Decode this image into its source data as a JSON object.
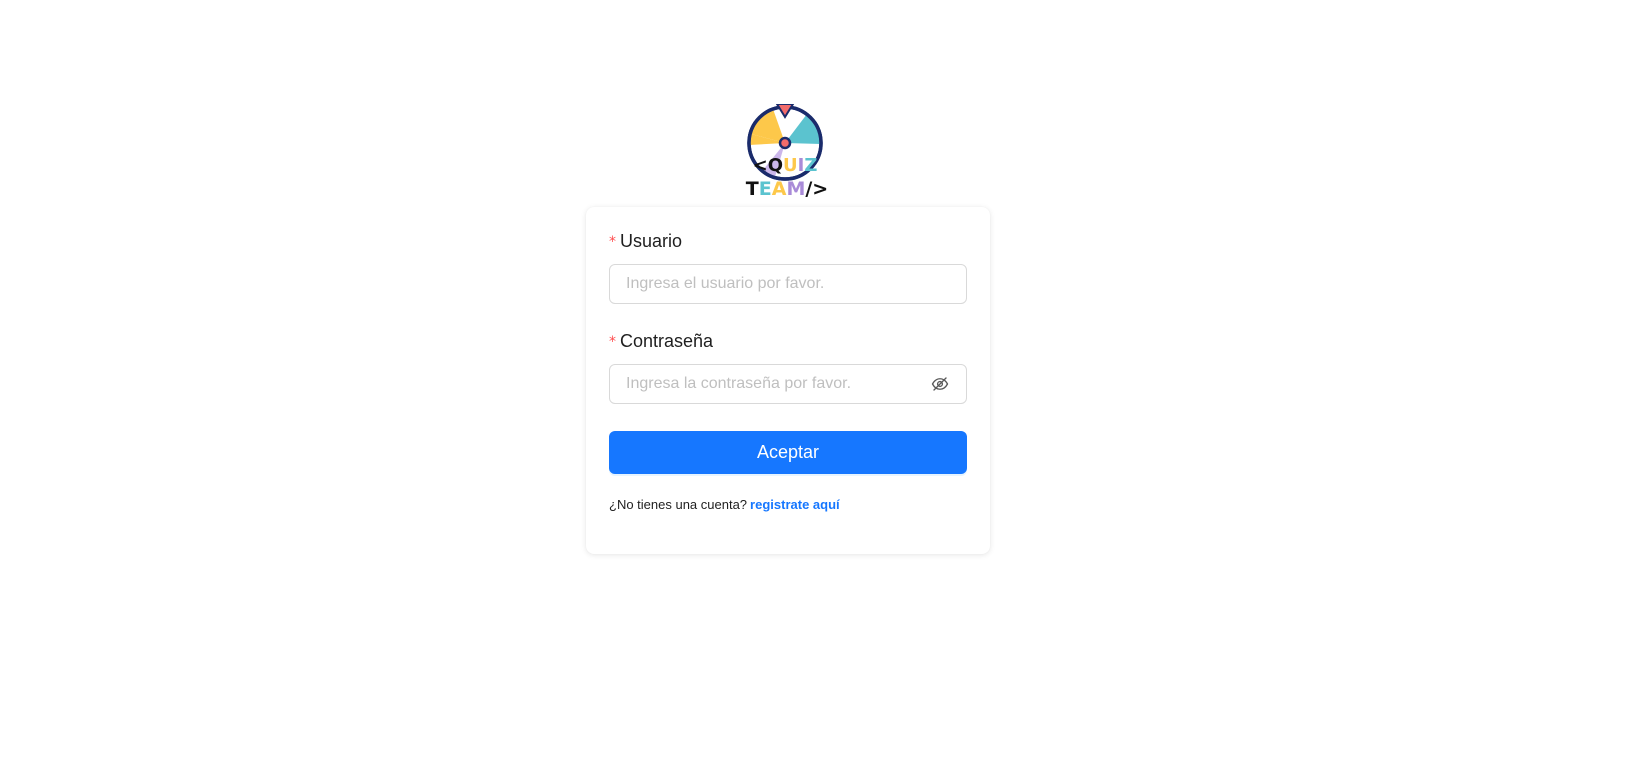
{
  "logo": {
    "alt": "QUIZ TEAM logo",
    "line1": "<QUIZ",
    "line2": "TEAM/>",
    "colors": {
      "navy": "#1a2b6b",
      "yellow": "#fdc84a",
      "teal": "#5bc3cf",
      "pink": "#f26b6b",
      "purple": "#a98bd8"
    }
  },
  "form": {
    "username": {
      "label": "Usuario",
      "required_mark": "*",
      "placeholder": "Ingresa el usuario por favor.",
      "value": ""
    },
    "password": {
      "label": "Contraseña",
      "required_mark": "*",
      "placeholder": "Ingresa la contraseña por favor.",
      "value": "",
      "toggle_icon": "eye-invisible-icon"
    },
    "submit_label": "Aceptar",
    "signup_prompt": "¿No tienes una cuenta?",
    "signup_link": "registrate aquí"
  },
  "theme": {
    "primary": "#1677ff",
    "required": "#ff4d4f",
    "border": "#d9d9d9"
  }
}
